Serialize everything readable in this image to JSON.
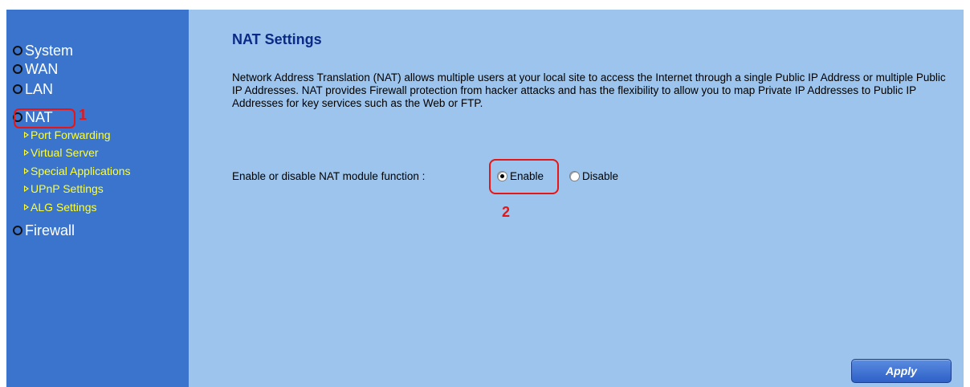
{
  "sidebar": {
    "items": [
      {
        "label": "System"
      },
      {
        "label": "WAN"
      },
      {
        "label": "LAN"
      },
      {
        "label": "NAT"
      },
      {
        "label": "Firewall"
      }
    ],
    "nat_subitems": [
      {
        "label": "Port Forwarding"
      },
      {
        "label": "Virtual Server"
      },
      {
        "label": "Special Applications"
      },
      {
        "label": "UPnP Settings"
      },
      {
        "label": "ALG Settings"
      }
    ]
  },
  "annotations": {
    "step1": "1",
    "step2": "2"
  },
  "main": {
    "title": "NAT Settings",
    "description": "Network Address Translation (NAT) allows multiple users at your local site to access the Internet through a single Public IP Address or multiple Public IP Addresses. NAT provides Firewall protection from hacker attacks and has the flexibility to allow you to map Private IP Addresses to Public IP Addresses for key services such as the Web or FTP.",
    "nat_label": "Enable or disable NAT module function :",
    "options": [
      {
        "label": "Enable",
        "checked": true
      },
      {
        "label": "Disable",
        "checked": false
      }
    ],
    "apply_label": "Apply"
  },
  "colors": {
    "sidebar_bg": "#3a74cc",
    "main_bg": "#9cc4ec",
    "sub_item": "#ffff33",
    "title": "#0a2a86",
    "annotation_red": "#e81515"
  }
}
